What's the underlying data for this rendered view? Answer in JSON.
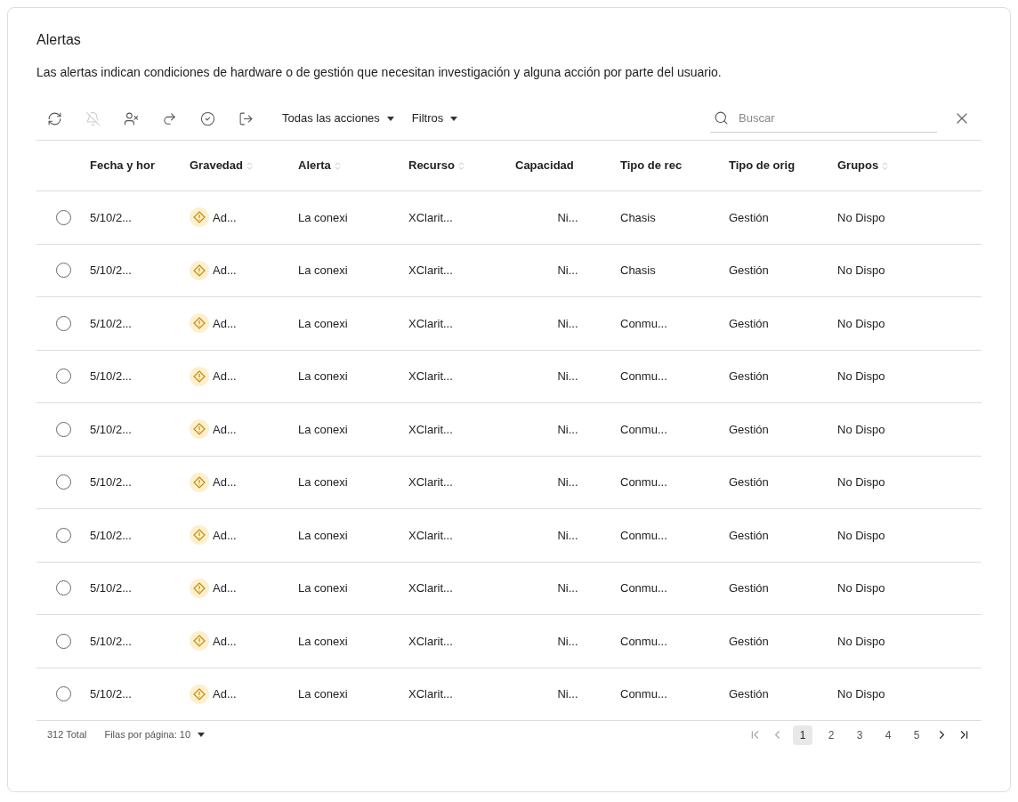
{
  "title": "Alertas",
  "description": "Las alertas indican condiciones de hardware o de gestión que necesitan investigación y alguna acción por parte del usuario.",
  "toolbar": {
    "icons": [
      {
        "kind": "refresh",
        "disabled": false
      },
      {
        "kind": "bell",
        "disabled": true
      },
      {
        "kind": "exclude",
        "disabled": false
      },
      {
        "kind": "forward",
        "disabled": false
      },
      {
        "kind": "circle",
        "disabled": false
      },
      {
        "kind": "export",
        "disabled": false
      }
    ],
    "menus": [
      "Todas las acciones",
      "Filtros"
    ],
    "search": {
      "placeholder": "Buscar"
    }
  },
  "table": {
    "columns": [
      {
        "label": "Fecha y hor",
        "sortable": false
      },
      {
        "label": "Gravedad",
        "sortable": true
      },
      {
        "label": "Alerta",
        "sortable": true
      },
      {
        "label": "Recurso",
        "sortable": true
      },
      {
        "label": "Capacidad",
        "sortable": false
      },
      {
        "label": "Tipo de rec",
        "sortable": false
      },
      {
        "label": "Tipo de orig",
        "sortable": false
      },
      {
        "label": "Grupos",
        "sortable": true
      }
    ],
    "rows": [
      {
        "selected": false,
        "cells": [
          "5/10/2...",
          "Ad...",
          "La conexi",
          "XClarit...",
          "Ni...",
          "Chasis",
          "Gestión",
          "No Dispo"
        ]
      },
      {
        "selected": false,
        "cells": [
          "5/10/2...",
          "Ad...",
          "La conexi",
          "XClarit...",
          "Ni...",
          "Chasis",
          "Gestión",
          "No Dispo"
        ]
      },
      {
        "selected": false,
        "cells": [
          "5/10/2...",
          "Ad...",
          "La conexi",
          "XClarit...",
          "Ni...",
          "Conmu...",
          "Gestión",
          "No Dispo"
        ]
      },
      {
        "selected": false,
        "cells": [
          "5/10/2...",
          "Ad...",
          "La conexi",
          "XClarit...",
          "Ni...",
          "Conmu...",
          "Gestión",
          "No Dispo"
        ]
      },
      {
        "selected": false,
        "cells": [
          "5/10/2...",
          "Ad...",
          "La conexi",
          "XClarit...",
          "Ni...",
          "Conmu...",
          "Gestión",
          "No Dispo"
        ]
      },
      {
        "selected": false,
        "cells": [
          "5/10/2...",
          "Ad...",
          "La conexi",
          "XClarit...",
          "Ni...",
          "Conmu...",
          "Gestión",
          "No Dispo"
        ]
      },
      {
        "selected": false,
        "cells": [
          "5/10/2...",
          "Ad...",
          "La conexi",
          "XClarit...",
          "Ni...",
          "Conmu...",
          "Gestión",
          "No Dispo"
        ]
      },
      {
        "selected": false,
        "cells": [
          "5/10/2...",
          "Ad...",
          "La conexi",
          "XClarit...",
          "Ni...",
          "Conmu...",
          "Gestión",
          "No Dispo"
        ]
      },
      {
        "selected": false,
        "cells": [
          "5/10/2...",
          "Ad...",
          "La conexi",
          "XClarit...",
          "Ni...",
          "Conmu...",
          "Gestión",
          "No Dispo"
        ]
      },
      {
        "selected": false,
        "cells": [
          "5/10/2...",
          "Ad...",
          "La conexi",
          "XClarit...",
          "Ni...",
          "Conmu...",
          "Gestión",
          "No Dispo"
        ]
      }
    ]
  },
  "footer": {
    "total": "312 Total",
    "rows_per_page": "Filas por página: 10",
    "pages": [
      {
        "label": "1",
        "selected": true
      },
      {
        "label": "2",
        "selected": false
      },
      {
        "label": "3",
        "selected": false
      },
      {
        "label": "4",
        "selected": false
      },
      {
        "label": "5",
        "selected": false
      }
    ]
  }
}
